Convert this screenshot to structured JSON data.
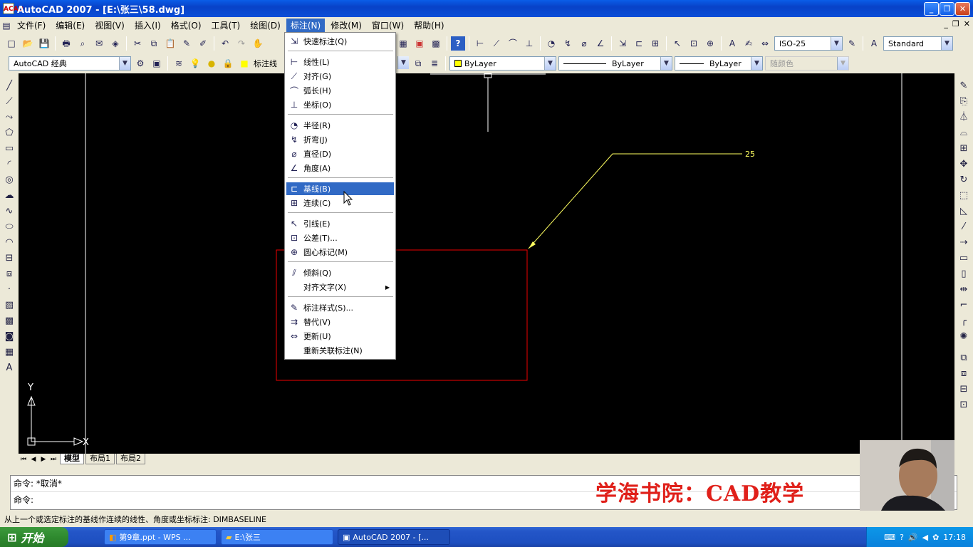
{
  "window": {
    "title": "AutoCAD 2007 - [E:\\张三\\58.dwg]",
    "app_icon": "ACAD"
  },
  "menubar": [
    {
      "label": "文件(F)"
    },
    {
      "label": "编辑(E)"
    },
    {
      "label": "视图(V)"
    },
    {
      "label": "插入(I)"
    },
    {
      "label": "格式(O)"
    },
    {
      "label": "工具(T)"
    },
    {
      "label": "绘图(D)"
    },
    {
      "label": "标注(N)"
    },
    {
      "label": "修改(M)"
    },
    {
      "label": "窗口(W)"
    },
    {
      "label": "帮助(H)"
    }
  ],
  "toolbar": {
    "dimstyle_value": "ISO-25",
    "textstyle_value": "Standard",
    "workspace_value": "AutoCAD 经典",
    "layer_value": "标注线",
    "color_value": "ByLayer",
    "linetype_value": "ByLayer",
    "lineweight_value": "ByLayer",
    "plotstyle_value": "随颜色"
  },
  "dimension_menu": {
    "items": [
      {
        "label": "快速标注(Q)",
        "icon": "quick-dim-icon"
      },
      {
        "label": "线性(L)",
        "icon": "linear-dim-icon"
      },
      {
        "label": "对齐(G)",
        "icon": "aligned-dim-icon"
      },
      {
        "label": "弧长(H)",
        "icon": "arc-length-icon"
      },
      {
        "label": "坐标(O)",
        "icon": "ordinate-icon"
      },
      {
        "label": "半径(R)",
        "icon": "radius-icon"
      },
      {
        "label": "折弯(J)",
        "icon": "jogged-icon"
      },
      {
        "label": "直径(D)",
        "icon": "diameter-icon"
      },
      {
        "label": "角度(A)",
        "icon": "angular-icon"
      },
      {
        "label": "基线(B)",
        "icon": "baseline-icon"
      },
      {
        "label": "连续(C)",
        "icon": "continue-icon"
      },
      {
        "label": "引线(E)",
        "icon": "leader-icon"
      },
      {
        "label": "公差(T)...",
        "icon": "tolerance-icon"
      },
      {
        "label": "圆心标记(M)",
        "icon": "center-mark-icon"
      },
      {
        "label": "倾斜(Q)",
        "icon": "oblique-icon"
      },
      {
        "label": "对齐文字(X)",
        "icon": ""
      },
      {
        "label": "标注样式(S)...",
        "icon": "dim-style-icon"
      },
      {
        "label": "替代(V)",
        "icon": "override-icon"
      },
      {
        "label": "更新(U)",
        "icon": "update-icon"
      },
      {
        "label": "重新关联标注(N)",
        "icon": ""
      }
    ],
    "highlighted": "基线(B)"
  },
  "drawing": {
    "leader_text": "25",
    "ucs_x": "X",
    "ucs_y": "Y"
  },
  "layout_tabs": [
    "模型",
    "布局1",
    "布局2"
  ],
  "command": {
    "line1": "命令: *取消*",
    "line2": "命令:"
  },
  "watermark": "学海书院：CAD教学",
  "status_text": "从上一个或选定标注的基线作连续的线性、角度或坐标标注:  DIMBASELINE",
  "taskbar": {
    "start_label": "开始",
    "tasks": [
      "第9章.ppt - WPS ...",
      "E:\\张三",
      "AutoCAD 2007 - [..."
    ],
    "clock": "17:18"
  }
}
